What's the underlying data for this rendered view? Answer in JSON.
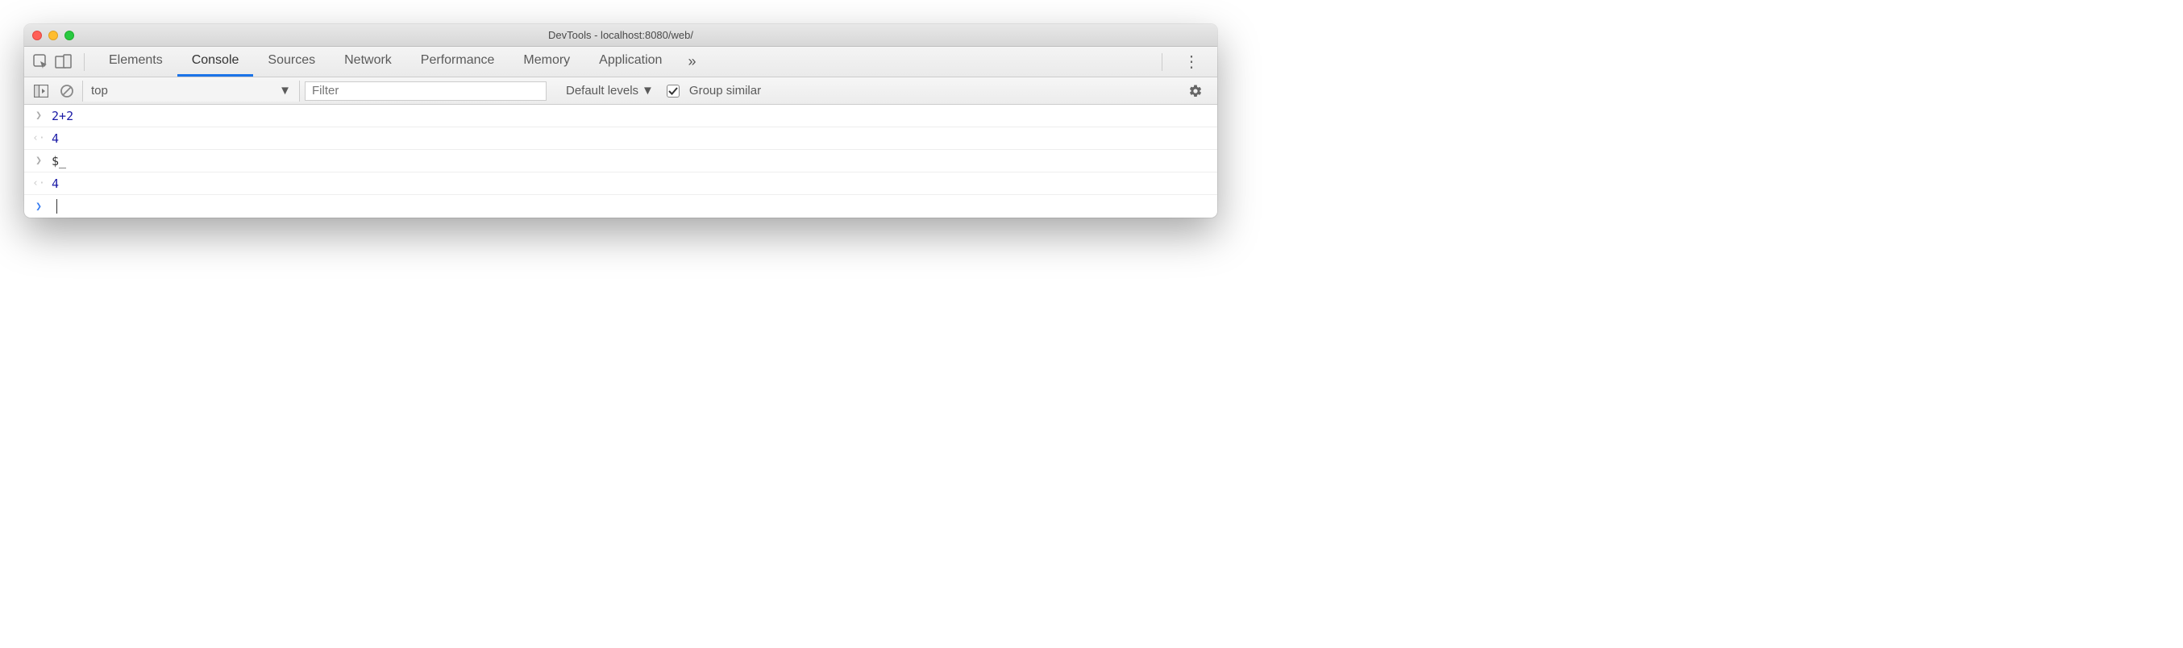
{
  "window": {
    "title": "DevTools - localhost:8080/web/"
  },
  "tabs": {
    "items": [
      "Elements",
      "Console",
      "Sources",
      "Network",
      "Performance",
      "Memory",
      "Application"
    ],
    "active": "Console",
    "overflow_glyph": "»"
  },
  "toolbar": {
    "context": "top",
    "filter_placeholder": "Filter",
    "levels_label": "Default levels",
    "group_checked": true,
    "group_label": "Group similar"
  },
  "console_rows": [
    {
      "kind": "input",
      "segments": [
        {
          "t": "2",
          "c": "num"
        },
        {
          "t": "+",
          "c": "op"
        },
        {
          "t": "2",
          "c": "num"
        }
      ]
    },
    {
      "kind": "output",
      "segments": [
        {
          "t": "4",
          "c": "result"
        }
      ]
    },
    {
      "kind": "input",
      "segments": [
        {
          "t": "$_",
          "c": "dark"
        }
      ]
    },
    {
      "kind": "output",
      "segments": [
        {
          "t": "4",
          "c": "result"
        }
      ]
    },
    {
      "kind": "prompt"
    }
  ]
}
